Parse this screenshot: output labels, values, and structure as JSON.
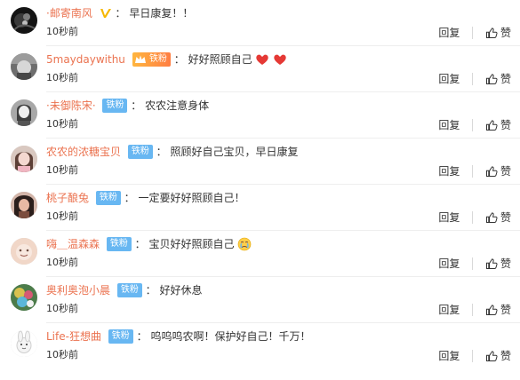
{
  "comments": [
    {
      "name": "·邮寄南风",
      "verified_icon": "gold-v-icon",
      "badge_label": "",
      "content": "早日康复！！",
      "time": "10秒前",
      "reply_label": "回复",
      "like_label": "赞",
      "avatar_icon": "avatar-dark-flower"
    },
    {
      "name": "5maydaywithu",
      "badge_label": "铁粉",
      "badge_style": "super-fan",
      "content": "好好照顾自己",
      "emoji": [
        "heart-icon",
        "heart-icon"
      ],
      "time": "10秒前",
      "reply_label": "回复",
      "like_label": "赞",
      "avatar_icon": "avatar-gray-selfie"
    },
    {
      "name": "·未御陈宋·",
      "badge_label": "铁粉",
      "badge_style": "iron-fan",
      "content": "农农注意身体",
      "time": "10秒前",
      "reply_label": "回复",
      "like_label": "赞",
      "avatar_icon": "avatar-mono-portrait"
    },
    {
      "name": "农农的浓糖宝贝",
      "badge_label": "铁粉",
      "badge_style": "iron-fan",
      "content": "照顾好自己宝贝，早日康复",
      "time": "10秒前",
      "reply_label": "回复",
      "like_label": "赞",
      "avatar_icon": "avatar-soft-portrait"
    },
    {
      "name": "桃子酿兔",
      "badge_label": "铁粉",
      "badge_style": "iron-fan",
      "content": "一定要好好照顾自己！",
      "time": "10秒前",
      "reply_label": "回复",
      "like_label": "赞",
      "avatar_icon": "avatar-dark-hair"
    },
    {
      "name": "嗨＿温森森",
      "badge_label": "铁粉",
      "badge_style": "iron-fan",
      "content": "宝贝好好照顾自己",
      "emoji": [
        "crying-face-icon"
      ],
      "time": "10秒前",
      "reply_label": "回复",
      "like_label": "赞",
      "avatar_icon": "avatar-cartoon-beige"
    },
    {
      "name": "奥利奥泡小晨",
      "badge_label": "铁粉",
      "badge_style": "iron-fan",
      "content": "好好休息",
      "time": "10秒前",
      "reply_label": "回复",
      "like_label": "赞",
      "avatar_icon": "avatar-colorful-art"
    },
    {
      "name": "Life-狂想曲",
      "badge_label": "铁粉",
      "badge_style": "iron-fan",
      "content": "呜呜呜农啊！保护好自己！千万！",
      "time": "10秒前",
      "reply_label": "回复",
      "like_label": "赞",
      "avatar_icon": "avatar-cartoon-rabbit"
    }
  ],
  "colors": {
    "username": "#eb7350",
    "iron_fan_badge": "#68b7f2",
    "super_fan_badge": "#ff9f3d",
    "text": "#333333",
    "divider": "#eeeeee"
  }
}
